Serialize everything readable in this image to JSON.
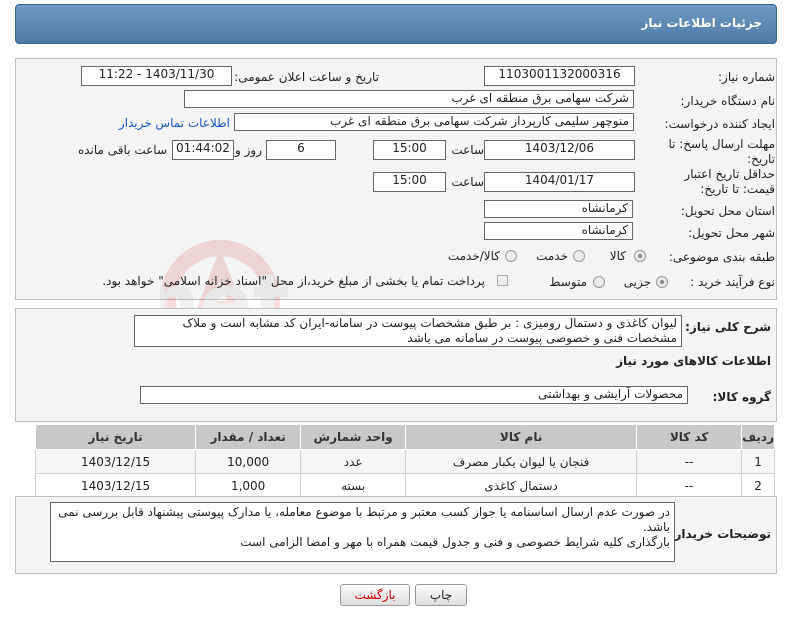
{
  "header": {
    "title": "جزئیات اطلاعات نیاز"
  },
  "form": {
    "need_number_label": "شماره نیاز:",
    "need_number": "1103001132000316",
    "announce_label": "تاریخ و ساعت اعلان عمومی:",
    "announce_value": "1403/11/30 - 11:22",
    "buyer_org_label": "نام دستگاه خریدار:",
    "buyer_org": "شرکت سهامی برق منطقه ای غرب",
    "creator_label": "ایجاد کننده درخواست:",
    "creator": "منوچهر  سلیمی کارپرداز شرکت سهامی برق منطقه ای غرب",
    "contact_link": "اطلاعات تماس خریدار",
    "deadline_label": "مهلت ارسال پاسخ: تا تاریخ:",
    "deadline_date": "1403/12/06",
    "time_label": "ساعت",
    "deadline_time": "15:00",
    "days_value": "6",
    "days_label": "روز و",
    "remaining_time": "01:44:02",
    "remaining_label": "ساعت باقی مانده",
    "validity_label": "حداقل تاریخ اعتبار قیمت: تا تاریخ:",
    "validity_date": "1404/01/17",
    "validity_time": "15:00",
    "province_label": "استان محل تحویل:",
    "province": "کرمانشاه",
    "city_label": "شهر محل تحویل:",
    "city": "کرمانشاه",
    "category_label": "طبقه بندی موضوعی:",
    "category_options": [
      "کالا",
      "خدمت",
      "کالا/خدمت"
    ],
    "process_label": "نوع فرآیند خرید :",
    "process_options": [
      "جزیی",
      "متوسط"
    ],
    "payment_note": "پرداخت تمام یا بخشی از مبلغ خرید،از محل \"اسناد خزانه اسلامی\" خواهد بود."
  },
  "description": {
    "label": "شرح کلی نیاز:",
    "text_line1": "لیوان کاغذی و دستمال رومیزی : بر طبق مشخصات پیوست در سامانه-ایران کد مشابه است و ملاک",
    "text_line2": "مشخصات فنی و خصوصی پیوست در سامانه می باشد"
  },
  "goods_info_title": "اطلاعات کالاهای مورد نیاز",
  "goods_group": {
    "label": "گروه کالا:",
    "value": "محصولات آرایشی و بهداشتی"
  },
  "table": {
    "headers": [
      "ردیف",
      "کد کالا",
      "نام کالا",
      "واحد شمارش",
      "تعداد / مقدار",
      "تاریخ نیاز"
    ],
    "rows": [
      [
        "1",
        "--",
        "فنجان یا لیوان یکبار مصرف",
        "عدد",
        "10,000",
        "1403/12/15"
      ],
      [
        "2",
        "--",
        "دستمال کاغذی",
        "بسته",
        "1,000",
        "1403/12/15"
      ]
    ]
  },
  "buyer_notes": {
    "label": "توضیحات خریدار:",
    "line1": "در صورت عدم ارسال اساسنامه یا جواز کسب معتبر و مرتبط با موضوع معامله،  یا مدارک پیوستی پیشنهاد قابل بررسی نمی",
    "line2": "باشد.",
    "line3": "بارگذاری کلیه شرایط خصوصی و فنی و جدول قیمت همراه با مهر و امضا الزامی است"
  },
  "buttons": {
    "print": "چاپ",
    "back": "بازگشت"
  }
}
